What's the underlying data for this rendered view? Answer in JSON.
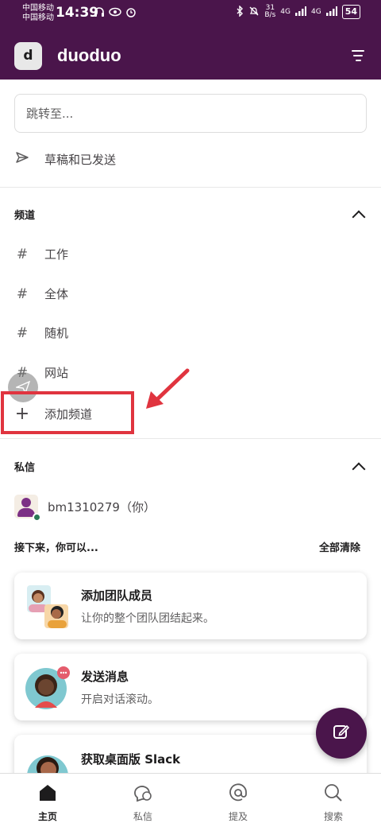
{
  "status_bar": {
    "carrier_1": "中国移动",
    "carrier_2": "中国移动",
    "time": "14:39",
    "net_speed_value": "31",
    "net_speed_unit": "B/s",
    "signal_1": "4G",
    "signal_2": "4G",
    "battery": "54"
  },
  "header": {
    "workspace_initial": "d",
    "workspace_name": "duoduo"
  },
  "search": {
    "placeholder": "跳转至..."
  },
  "drafts": {
    "label": "草稿和已发送"
  },
  "channels": {
    "title": "频道",
    "items": [
      {
        "label": "工作"
      },
      {
        "label": "全体"
      },
      {
        "label": "随机"
      },
      {
        "label": "网站"
      }
    ],
    "add_label": "添加频道"
  },
  "dms": {
    "title": "私信",
    "user": "bm1310279（你）"
  },
  "next": {
    "title": "接下来，你可以...",
    "clear_all": "全部清除"
  },
  "cards": [
    {
      "title": "添加团队成员",
      "desc": "让你的整个团队团结起来。"
    },
    {
      "title": "发送消息",
      "desc": "开启对话滚动。"
    },
    {
      "title": "获取桌面版 Slack",
      "desc": ""
    }
  ],
  "bottom_nav": {
    "home": "主页",
    "dms": "私信",
    "mentions": "提及",
    "search": "搜索"
  },
  "colors": {
    "brand": "#4a154b",
    "highlight": "#e0343f",
    "presence": "#2a7a55"
  }
}
